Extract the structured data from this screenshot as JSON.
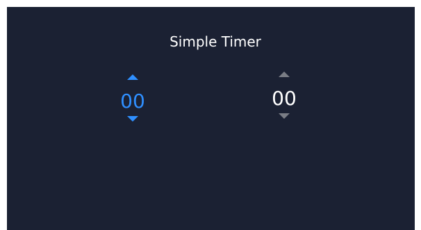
{
  "app": {
    "title": "Simple Timer"
  },
  "timer": {
    "minutes": {
      "value": "00",
      "active": true,
      "up_icon": "caret-up-icon",
      "down_icon": "caret-down-icon"
    },
    "seconds": {
      "value": "00",
      "active": false,
      "up_icon": "caret-up-icon",
      "down_icon": "caret-down-icon"
    }
  },
  "colors": {
    "background": "#1b2133",
    "active_accent": "#2f8fff",
    "inactive_arrow": "#7a7d85",
    "text": "#ffffff"
  }
}
